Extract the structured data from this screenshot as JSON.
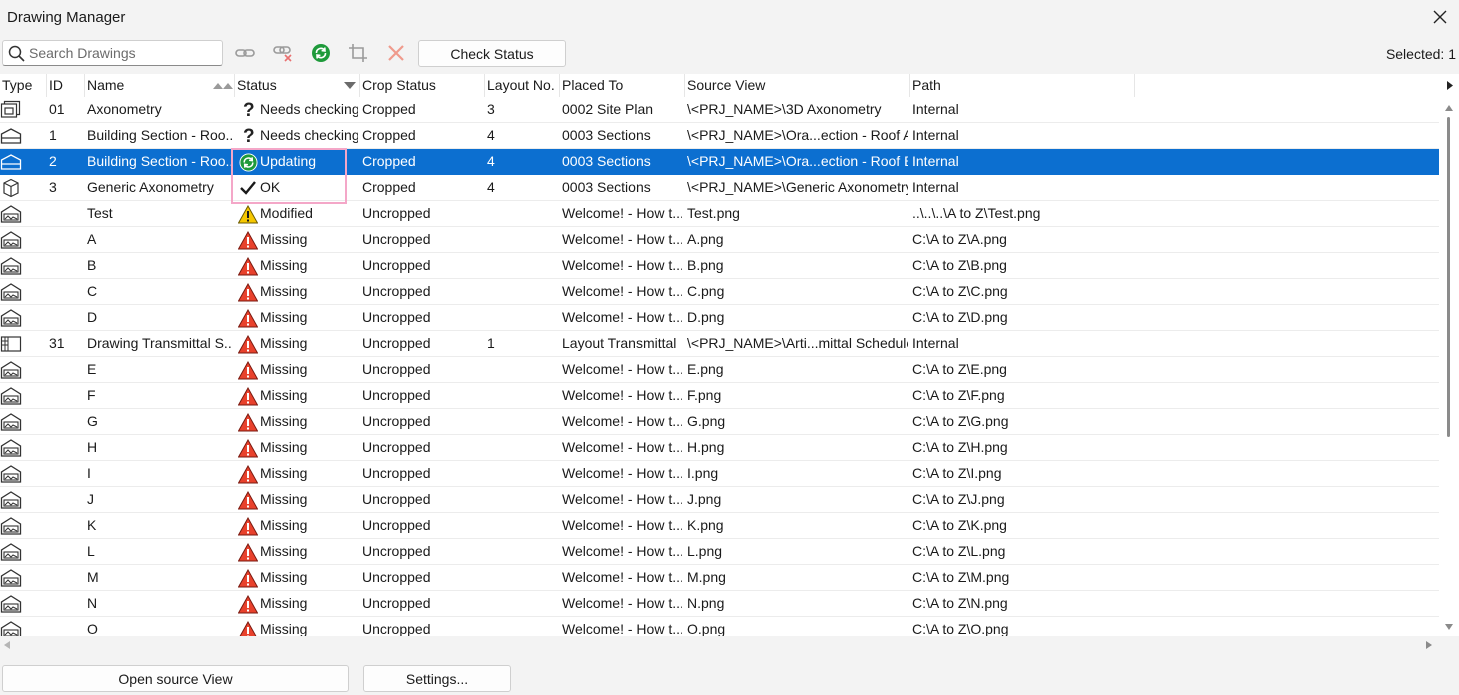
{
  "window": {
    "title": "Drawing Manager"
  },
  "toolbar": {
    "search_placeholder": "Search Drawings",
    "check_status_label": "Check Status",
    "selected_label": "Selected: 1"
  },
  "columns": [
    "Type",
    "ID",
    "Name",
    "Status",
    "Crop Status",
    "Layout No.",
    "Placed To",
    "Source View",
    "Path"
  ],
  "rows": [
    {
      "type": "axonometry",
      "id": "01",
      "name": "Axonometry",
      "status": "Needs checking",
      "status_icon": "question",
      "crop": "Cropped",
      "layout": "3",
      "placed": "0002 Site Plan",
      "source": "\\<PRJ_NAME>\\3D Axonometry",
      "path": "Internal"
    },
    {
      "type": "section",
      "id": "1",
      "name": "Building Section - Roo...",
      "status": "Needs checking",
      "status_icon": "question",
      "crop": "Cropped",
      "layout": "4",
      "placed": "0003 Sections",
      "source": "\\<PRJ_NAME>\\Ora...ection - Roof A",
      "path": "Internal"
    },
    {
      "type": "section",
      "id": "2",
      "name": "Building Section - Roo...",
      "status": "Updating",
      "status_icon": "updating",
      "crop": "Cropped",
      "layout": "4",
      "placed": "0003 Sections",
      "source": "\\<PRJ_NAME>\\Ora...ection - Roof B",
      "path": "Internal",
      "selected": true
    },
    {
      "type": "cube",
      "id": "3",
      "name": "Generic Axonometry",
      "status": "OK",
      "status_icon": "check",
      "crop": "Cropped",
      "layout": "4",
      "placed": "0003 Sections",
      "source": "\\<PRJ_NAME>\\Generic Axonometry",
      "path": "Internal"
    },
    {
      "type": "image",
      "id": "",
      "name": "Test",
      "status": "Modified",
      "status_icon": "warning",
      "crop": "Uncropped",
      "layout": "",
      "placed": "Welcome! - How t...",
      "source": "Test.png",
      "path": "..\\..\\..\\A to Z\\Test.png"
    },
    {
      "type": "image",
      "id": "",
      "name": "A",
      "status": "Missing",
      "status_icon": "missing",
      "crop": "Uncropped",
      "layout": "",
      "placed": "Welcome! - How t...",
      "source": "A.png",
      "path": "C:\\A to Z\\A.png"
    },
    {
      "type": "image",
      "id": "",
      "name": "B",
      "status": "Missing",
      "status_icon": "missing",
      "crop": "Uncropped",
      "layout": "",
      "placed": "Welcome! - How t...",
      "source": "B.png",
      "path": "C:\\A to Z\\B.png"
    },
    {
      "type": "image",
      "id": "",
      "name": "C",
      "status": "Missing",
      "status_icon": "missing",
      "crop": "Uncropped",
      "layout": "",
      "placed": "Welcome! - How t...",
      "source": "C.png",
      "path": "C:\\A to Z\\C.png"
    },
    {
      "type": "image",
      "id": "",
      "name": "D",
      "status": "Missing",
      "status_icon": "missing",
      "crop": "Uncropped",
      "layout": "",
      "placed": "Welcome! - How t...",
      "source": "D.png",
      "path": "C:\\A to Z\\D.png"
    },
    {
      "type": "schedule",
      "id": "31",
      "name": "Drawing Transmittal S...",
      "status": "Missing",
      "status_icon": "missing",
      "crop": "Uncropped",
      "layout": "1",
      "placed": "Layout Transmittal",
      "source": "\\<PRJ_NAME>\\Arti...mittal Schedule",
      "path": "Internal"
    },
    {
      "type": "image",
      "id": "",
      "name": "E",
      "status": "Missing",
      "status_icon": "missing",
      "crop": "Uncropped",
      "layout": "",
      "placed": "Welcome! - How t...",
      "source": "E.png",
      "path": "C:\\A to Z\\E.png"
    },
    {
      "type": "image",
      "id": "",
      "name": "F",
      "status": "Missing",
      "status_icon": "missing",
      "crop": "Uncropped",
      "layout": "",
      "placed": "Welcome! - How t...",
      "source": "F.png",
      "path": "C:\\A to Z\\F.png"
    },
    {
      "type": "image",
      "id": "",
      "name": "G",
      "status": "Missing",
      "status_icon": "missing",
      "crop": "Uncropped",
      "layout": "",
      "placed": "Welcome! - How t...",
      "source": "G.png",
      "path": "C:\\A to Z\\G.png"
    },
    {
      "type": "image",
      "id": "",
      "name": "H",
      "status": "Missing",
      "status_icon": "missing",
      "crop": "Uncropped",
      "layout": "",
      "placed": "Welcome! - How t...",
      "source": "H.png",
      "path": "C:\\A to Z\\H.png"
    },
    {
      "type": "image",
      "id": "",
      "name": "I",
      "status": "Missing",
      "status_icon": "missing",
      "crop": "Uncropped",
      "layout": "",
      "placed": "Welcome! - How t...",
      "source": "I.png",
      "path": "C:\\A to Z\\I.png"
    },
    {
      "type": "image",
      "id": "",
      "name": "J",
      "status": "Missing",
      "status_icon": "missing",
      "crop": "Uncropped",
      "layout": "",
      "placed": "Welcome! - How t...",
      "source": "J.png",
      "path": "C:\\A to Z\\J.png"
    },
    {
      "type": "image",
      "id": "",
      "name": "K",
      "status": "Missing",
      "status_icon": "missing",
      "crop": "Uncropped",
      "layout": "",
      "placed": "Welcome! - How t...",
      "source": "K.png",
      "path": "C:\\A to Z\\K.png"
    },
    {
      "type": "image",
      "id": "",
      "name": "L",
      "status": "Missing",
      "status_icon": "missing",
      "crop": "Uncropped",
      "layout": "",
      "placed": "Welcome! - How t...",
      "source": "L.png",
      "path": "C:\\A to Z\\L.png"
    },
    {
      "type": "image",
      "id": "",
      "name": "M",
      "status": "Missing",
      "status_icon": "missing",
      "crop": "Uncropped",
      "layout": "",
      "placed": "Welcome! - How t...",
      "source": "M.png",
      "path": "C:\\A to Z\\M.png"
    },
    {
      "type": "image",
      "id": "",
      "name": "N",
      "status": "Missing",
      "status_icon": "missing",
      "crop": "Uncropped",
      "layout": "",
      "placed": "Welcome! - How t...",
      "source": "N.png",
      "path": "C:\\A to Z\\N.png"
    },
    {
      "type": "image",
      "id": "",
      "name": "O",
      "status": "Missing",
      "status_icon": "missing",
      "crop": "Uncropped",
      "layout": "",
      "placed": "Welcome! - How t...",
      "source": "O.png",
      "path": "C:\\A to Z\\O.png"
    }
  ],
  "footer": {
    "open_source_label": "Open source View",
    "settings_label": "Settings..."
  },
  "colors": {
    "selection": "#0c6fd0",
    "highlight_box": "#f4a7c8",
    "ok_green": "#1e9a3a",
    "missing_red": "#e8412c",
    "warning_yellow": "#f6c700"
  }
}
